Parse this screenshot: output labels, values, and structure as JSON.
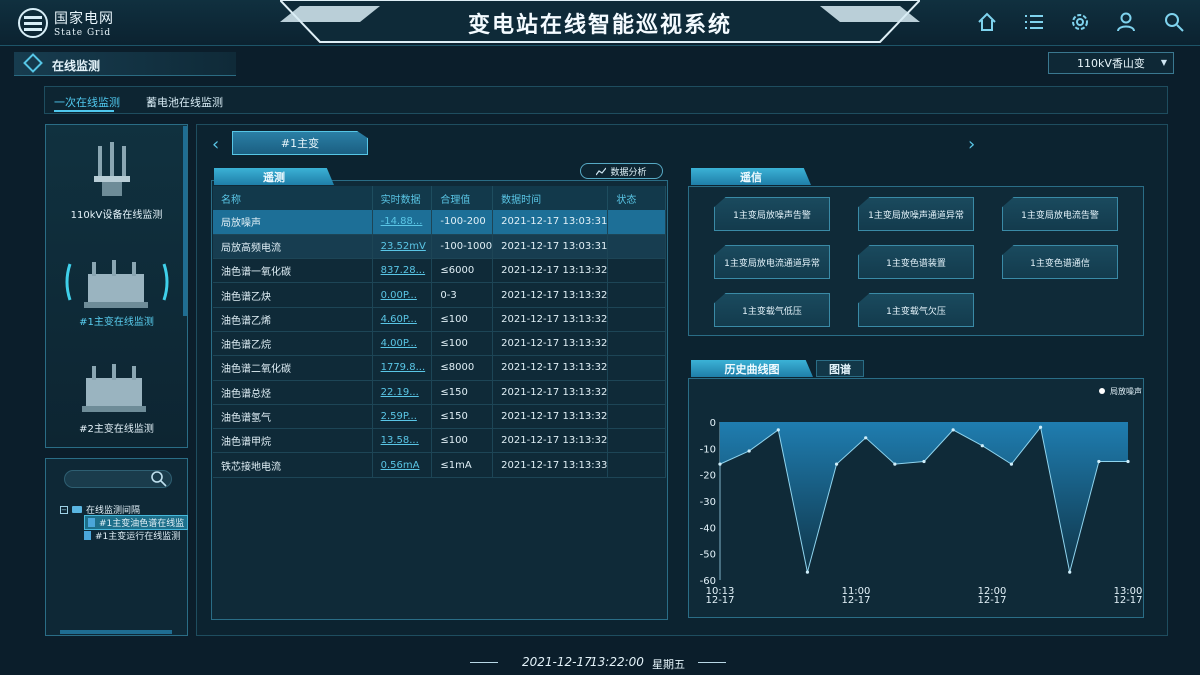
{
  "header": {
    "logo_cn": "国家电网",
    "logo_en": "State Grid",
    "title": "变电站在线智能巡视系统",
    "icons": [
      "home-icon",
      "list-icon",
      "gear-icon",
      "user-icon",
      "search-icon"
    ]
  },
  "section": {
    "title": "在线监测",
    "station_selected": "110kV香山变"
  },
  "tabs": [
    {
      "label": "一次在线监测",
      "active": true
    },
    {
      "label": "蓄电池在线监测",
      "active": false
    }
  ],
  "equipment": [
    {
      "label": "110kV设备在线监测"
    },
    {
      "label": "#1主变在线监测"
    },
    {
      "label": "#2主变在线监测"
    }
  ],
  "tree": {
    "root": "在线监测间隔",
    "children": [
      "#1主变油色谱在线监",
      "#1主变运行在线监测"
    ]
  },
  "transformer_tab": "#1主变",
  "telemetry": {
    "tab": "遥测",
    "analysis_button": "数据分析",
    "columns": [
      "名称",
      "实时数据",
      "合理值",
      "数据时间",
      "状态"
    ],
    "rows": [
      {
        "name": "局放噪声",
        "value": "-14.88...",
        "range": "-100-200",
        "time": "2021-12-17 13:03:31",
        "status": ""
      },
      {
        "name": "局放高频电流",
        "value": "23.52mV",
        "range": "-100-1000",
        "time": "2021-12-17 13:03:31",
        "status": ""
      },
      {
        "name": "油色谱一氧化碳",
        "value": "837.28...",
        "range": "≤6000",
        "time": "2021-12-17 13:13:32",
        "status": ""
      },
      {
        "name": "油色谱乙炔",
        "value": "0.00P...",
        "range": "0-3",
        "time": "2021-12-17 13:13:32",
        "status": ""
      },
      {
        "name": "油色谱乙烯",
        "value": "4.60P...",
        "range": "≤100",
        "time": "2021-12-17 13:13:32",
        "status": ""
      },
      {
        "name": "油色谱乙烷",
        "value": "4.00P...",
        "range": "≤100",
        "time": "2021-12-17 13:13:32",
        "status": ""
      },
      {
        "name": "油色谱二氧化碳",
        "value": "1779.8...",
        "range": "≤8000",
        "time": "2021-12-17 13:13:32",
        "status": ""
      },
      {
        "name": "油色谱总烃",
        "value": "22.19...",
        "range": "≤150",
        "time": "2021-12-17 13:13:32",
        "status": ""
      },
      {
        "name": "油色谱氢气",
        "value": "2.59P...",
        "range": "≤150",
        "time": "2021-12-17 13:13:32",
        "status": ""
      },
      {
        "name": "油色谱甲烷",
        "value": "13.58...",
        "range": "≤100",
        "time": "2021-12-17 13:13:32",
        "status": ""
      },
      {
        "name": "铁芯接地电流",
        "value": "0.56mA",
        "range": "≤1mA",
        "time": "2021-12-17 13:13:33",
        "status": ""
      }
    ]
  },
  "signals": {
    "tab": "遥信",
    "items": [
      "1主变局放噪声告警",
      "1主变局放噪声通道异常",
      "1主变局放电流告警",
      "1主变局放电流通道异常",
      "1主变色谱装置",
      "1主变色谱通信",
      "1主变载气低压",
      "1主变载气欠压"
    ]
  },
  "history": {
    "tab": "历史曲线图",
    "map_tab": "图谱"
  },
  "chart_data": {
    "type": "area",
    "series": [
      {
        "name": "局放噪声",
        "x": [
          "10:13",
          "10:28",
          "10:43",
          "10:58",
          "11:03",
          "11:13",
          "11:28",
          "11:38",
          "11:50",
          "12:10",
          "12:30",
          "12:45",
          "12:55",
          "13:00",
          "13:05"
        ],
        "values": [
          -16,
          -11,
          -3,
          -57,
          -16,
          -6,
          -16,
          -15,
          -3,
          -9,
          -16,
          -2,
          -57,
          -15,
          -15
        ]
      }
    ],
    "x_ticks": [
      {
        "time": "10:13",
        "date": "12-17"
      },
      {
        "time": "11:00",
        "date": "12-17"
      },
      {
        "time": "12:00",
        "date": "12-17"
      },
      {
        "time": "13:00",
        "date": "12-17"
      }
    ],
    "y_ticks": [
      0,
      -10,
      -20,
      -30,
      -40,
      -50,
      -60
    ],
    "ylim": [
      -60,
      0
    ],
    "legend": "top-right",
    "colors": {
      "line": "#8fd4ee",
      "fill_top": "#1f7db0",
      "fill_bottom": "#0f3447"
    }
  },
  "footer": {
    "date": "2021-12-17",
    "time": "13:22:00",
    "weekday": "星期五"
  }
}
